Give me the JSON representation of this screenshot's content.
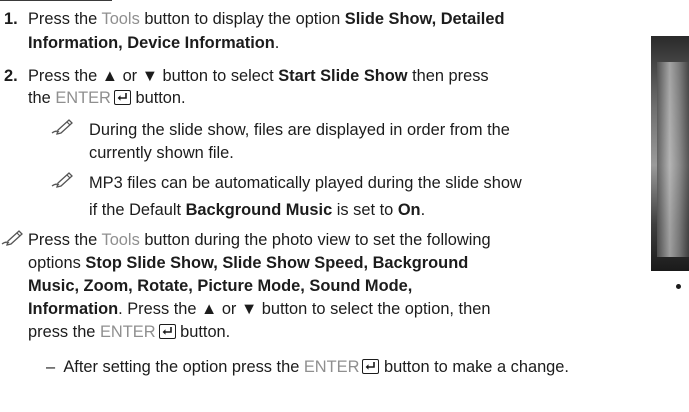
{
  "step1": {
    "number": "1.",
    "t1": "Press the ",
    "tools": "Tools",
    "t2": " button to display the option ",
    "b1": "Slide Show, Detailed",
    "b2": "Information, Device Information",
    "t3": "."
  },
  "step2": {
    "number": "2.",
    "t1": "Press the ▲ or ▼ button to select ",
    "b1": "Start Slide Show",
    "t2": " then press",
    "t3": "the ",
    "enter": "ENTER",
    "t4": " button."
  },
  "note1": {
    "l1": "During the slide show, files are displayed in order from the",
    "l2": "currently shown file."
  },
  "note2": {
    "l1": "MP3 files can be automatically played during the slide show",
    "t1": "if the Default ",
    "b1": "Background Music",
    "t2": " is set to ",
    "b2": "On",
    "t3": "."
  },
  "note3": {
    "t1": "Press the ",
    "tools": "Tools",
    "t2": " button during the photo view to set the following",
    "t3": "options ",
    "b1": "Stop Slide Show, Slide Show Speed, Background",
    "b2": "Music, Zoom, Rotate, Picture Mode, Sound Mode,",
    "b3": "Information",
    "t4": ". Press the ▲ or ▼ button to select the option, then",
    "t5": "press the ",
    "enter": "ENTER",
    "t6": " button."
  },
  "sub": {
    "dash": "–",
    "t1": "After setting the option press the ",
    "enter": "ENTER",
    "t2": " button to make a change."
  },
  "colors": {
    "text": "#1c1c1c",
    "gray_keyword": "#8f8f8f"
  },
  "icons": [
    "note-pencil-icon",
    "enter-key-icon"
  ]
}
